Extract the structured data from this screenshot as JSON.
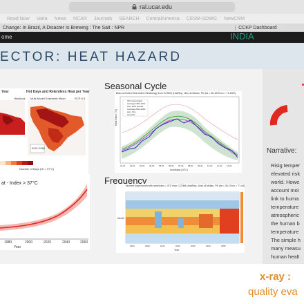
{
  "browser": {
    "url": "ral.ucar.edu",
    "bookmarks": [
      "Read Now",
      "Varia",
      "News",
      "NCAR",
      "Journals",
      "SEARCH",
      "CentralAmerica",
      "CESM-SDWG",
      "NewCRM"
    ],
    "tabs": [
      "Change: In Brazil, A Disaster Is Brewing : The Salt : NPR",
      "CCKP Dashboard"
    ]
  },
  "site": {
    "home_label": "ome",
    "region_tag": "INDIA"
  },
  "slide": {
    "title": "ECTOR: HEAT HAZARD",
    "map_panel": {
      "left_title": "Year",
      "right_title": "Hot Days and Relentless Heat per Year",
      "right_subtitle": "Multi-Model Ensemble Mean",
      "right_label": "RCP 8.5",
      "left_label": "Historical",
      "period_label": "2041-2060",
      "legend_caption": "Number of Days (HI > 37°C)"
    },
    "trend_panel": {
      "label": "at - Index > 37°C",
      "x_ticks": [
        "1980",
        "2000",
        "2020",
        "2040",
        "2060"
      ],
      "x_label": "Year"
    },
    "seasonal": {
      "heading": "Seasonal Cycle",
      "subtitle": "Bias-corrected Heat Index Climatology from CCSM4 (HadRep, 1km) at Mullan, PK (lat = 36.1875 lon = 71.4387)",
      "y_label": "Heat Index (°C)",
      "x_label": "monthday (UTC)",
      "x_ticks": [
        "01-01",
        "02-01",
        "03-01",
        "04-01",
        "05-01",
        "06-01",
        "07-01",
        "08-01",
        "09-01",
        "10-01",
        "11-01",
        "12-01"
      ],
      "legend": [
        "Obs Interpolated",
        "Average 1981-2010",
        "Hist. RCP spread",
        "Average 2041-2060",
        "Hist. Obs",
        "Avg Obs"
      ]
    },
    "frequency": {
      "heading": "Frequency",
      "subtitle": "Number days/month with heat index > 37C from CCSM4 (HadRep, 1km) at Mullan, PK (lat = 36.19 lon = 71.44)",
      "y_label": "Month",
      "x_label": "Year",
      "x_ticks": [
        "1990",
        "2000",
        "2010",
        "2020",
        "2030",
        "2040",
        "2050"
      ]
    },
    "narrative": {
      "heading": "Narrative:",
      "lines": [
        "Risig temper",
        "elevated risk",
        "world. Howe",
        "account moi",
        "link to huma",
        "temperature",
        "atmospheric",
        "the human b",
        "temperature",
        "The simple h",
        "many measu",
        "human healt"
      ]
    },
    "footer": {
      "brand": "x-ray : ",
      "tagline": "quality eva"
    }
  },
  "colors": {
    "accent_red": "#e0281e",
    "title_blue": "#2b4a6a",
    "india_green": "#1e9f86",
    "footer_orange": "#e58b2a"
  }
}
